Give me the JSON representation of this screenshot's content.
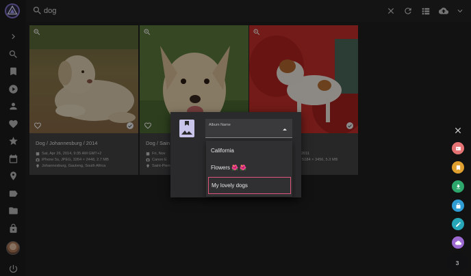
{
  "search": {
    "value": "dog"
  },
  "nav": {
    "icons": [
      "chevron-right-icon",
      "search-icon",
      "bookmark-icon",
      "play-icon",
      "person-icon",
      "heart-icon",
      "star-icon",
      "calendar-icon",
      "pin-icon",
      "label-icon",
      "folder-icon",
      "lock-icon",
      "power-icon"
    ]
  },
  "topbar": {
    "icons": [
      "clear-icon",
      "refresh-icon",
      "view-list-icon",
      "upload-icon",
      "chevron-down-icon"
    ]
  },
  "cards": [
    {
      "title": "Dog / Johannesburg / 2014",
      "date": "Sat, Apr 26, 2014, 9:35 AM GMT+2",
      "camera": "iPhone 5s, JPEG, 3264 × 2448, 2.7 MB",
      "location": "Johannesburg, Gauteng, South Africa"
    },
    {
      "title": "Dog / Sain",
      "date": "Fri, Nov",
      "camera": "Canon E",
      "location": "Saint-Pierre, La Réunion,"
    },
    {
      "title": "",
      "date": "2011",
      "camera": "D, 5184 × 3456, 5.3 MB",
      "location": ""
    }
  ],
  "dialog": {
    "select_label": "Album Name",
    "options": [
      "California",
      "Flowers 🌺 🌺",
      "My lovely dogs"
    ],
    "selected": "My lovely dogs"
  },
  "actions": {
    "buttons": [
      {
        "name": "share-button",
        "icon": "share-icon",
        "color": "#e57373"
      },
      {
        "name": "album-button",
        "icon": "bookmark-icon",
        "color": "#e0a030"
      },
      {
        "name": "download-button",
        "icon": "download-icon",
        "color": "#2ea76c"
      },
      {
        "name": "private-button",
        "icon": "lock-icon",
        "color": "#2f9cd4"
      },
      {
        "name": "edit-button",
        "icon": "pencil-icon",
        "color": "#27a6b8"
      },
      {
        "name": "cloud-button",
        "icon": "cloud-icon",
        "color": "#9c6ad0"
      }
    ],
    "count": "3"
  }
}
